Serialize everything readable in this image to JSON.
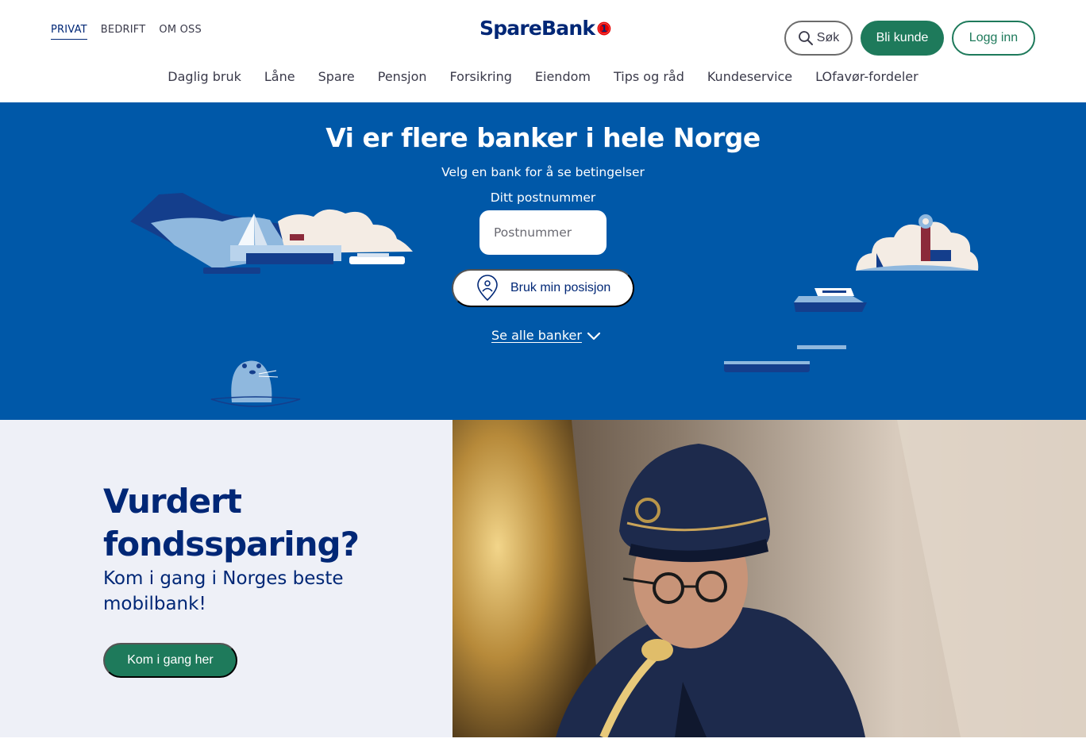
{
  "header": {
    "segments": [
      {
        "label": "PRIVAT",
        "active": true
      },
      {
        "label": "BEDRIFT",
        "active": false
      },
      {
        "label": "OM OSS",
        "active": false
      }
    ],
    "logo_text": "SpareBank",
    "logo_badge": "1",
    "search_label": "Søk",
    "join_label": "Bli kunde",
    "login_label": "Logg inn"
  },
  "nav": {
    "items": [
      "Daglig bruk",
      "Låne",
      "Spare",
      "Pensjon",
      "Forsikring",
      "Eiendom",
      "Tips og råd",
      "Kundeservice",
      "LOfavør-fordeler"
    ]
  },
  "hero": {
    "title": "Vi er flere banker i hele Norge",
    "subtitle": "Velg en bank for å se betingelser",
    "zip_label": "Ditt postnummer",
    "zip_placeholder": "Postnummer",
    "position_label": "Bruk min posisjon",
    "all_banks_label": "Se alle banker"
  },
  "promo": {
    "title": "Vurdert fondssparing?",
    "subtitle": "Kom i gang i Norges beste mobilbank!",
    "cta_label": "Kom i gang her"
  },
  "colors": {
    "brand_navy": "#002776",
    "hero_blue": "#0058a8",
    "accent_green": "#1e7a5b",
    "logo_red": "#e60000",
    "promo_bg": "#eef0f7"
  }
}
